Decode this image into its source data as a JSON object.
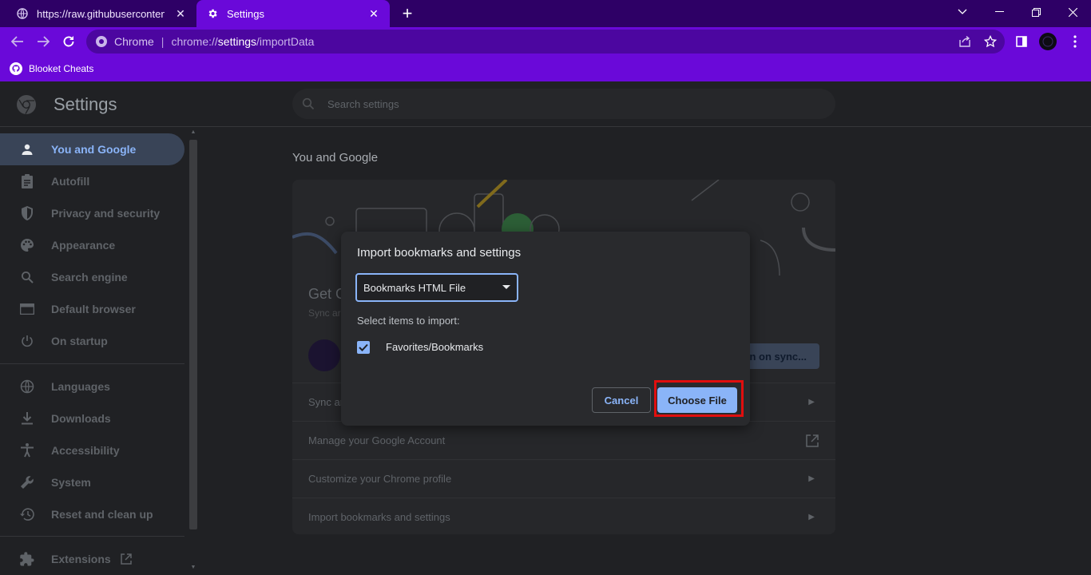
{
  "tabs": [
    {
      "title": "https://raw.githubusercontent.com",
      "icon": "globe-icon"
    },
    {
      "title": "Settings",
      "icon": "gear-icon"
    }
  ],
  "omnibox": {
    "chip": "Chrome",
    "url_scheme": "chrome://",
    "url_host": "settings",
    "url_path": "/importData"
  },
  "bookmarks_bar": [
    {
      "label": "Blooket Cheats",
      "icon": "github-icon"
    }
  ],
  "settings": {
    "title": "Settings",
    "search_placeholder": "Search settings"
  },
  "sidebar": {
    "items": [
      {
        "label": "You and Google",
        "icon": "person-icon"
      },
      {
        "label": "Autofill",
        "icon": "clipboard-icon"
      },
      {
        "label": "Privacy and security",
        "icon": "shield-icon"
      },
      {
        "label": "Appearance",
        "icon": "palette-icon"
      },
      {
        "label": "Search engine",
        "icon": "search-icon"
      },
      {
        "label": "Default browser",
        "icon": "browser-icon"
      },
      {
        "label": "On startup",
        "icon": "power-icon"
      },
      {
        "label": "Languages",
        "icon": "globe-icon"
      },
      {
        "label": "Downloads",
        "icon": "download-icon"
      },
      {
        "label": "Accessibility",
        "icon": "accessibility-icon"
      },
      {
        "label": "System",
        "icon": "wrench-icon"
      },
      {
        "label": "Reset and clean up",
        "icon": "history-icon"
      },
      {
        "label": "Extensions",
        "icon": "puzzle-icon"
      }
    ]
  },
  "main": {
    "section_title": "You and Google",
    "card_heading": "Get G",
    "card_sub": "Sync ar",
    "sync_button": "rn on sync...",
    "rows": [
      {
        "label": "Sync ar"
      },
      {
        "label": "Manage your Google Account"
      },
      {
        "label": "Customize your Chrome profile"
      },
      {
        "label": "Import bookmarks and settings"
      }
    ]
  },
  "dialog": {
    "title": "Import bookmarks and settings",
    "select_value": "Bookmarks HTML File",
    "items_label": "Select items to import:",
    "checkbox_label": "Favorites/Bookmarks",
    "checkbox_checked": true,
    "cancel_label": "Cancel",
    "choose_label": "Choose File"
  },
  "colors": {
    "tabstrip": "#2e0066",
    "toolbar": "#6a09d9",
    "accent": "#8ab4f8",
    "highlight": "#e00e0e"
  }
}
